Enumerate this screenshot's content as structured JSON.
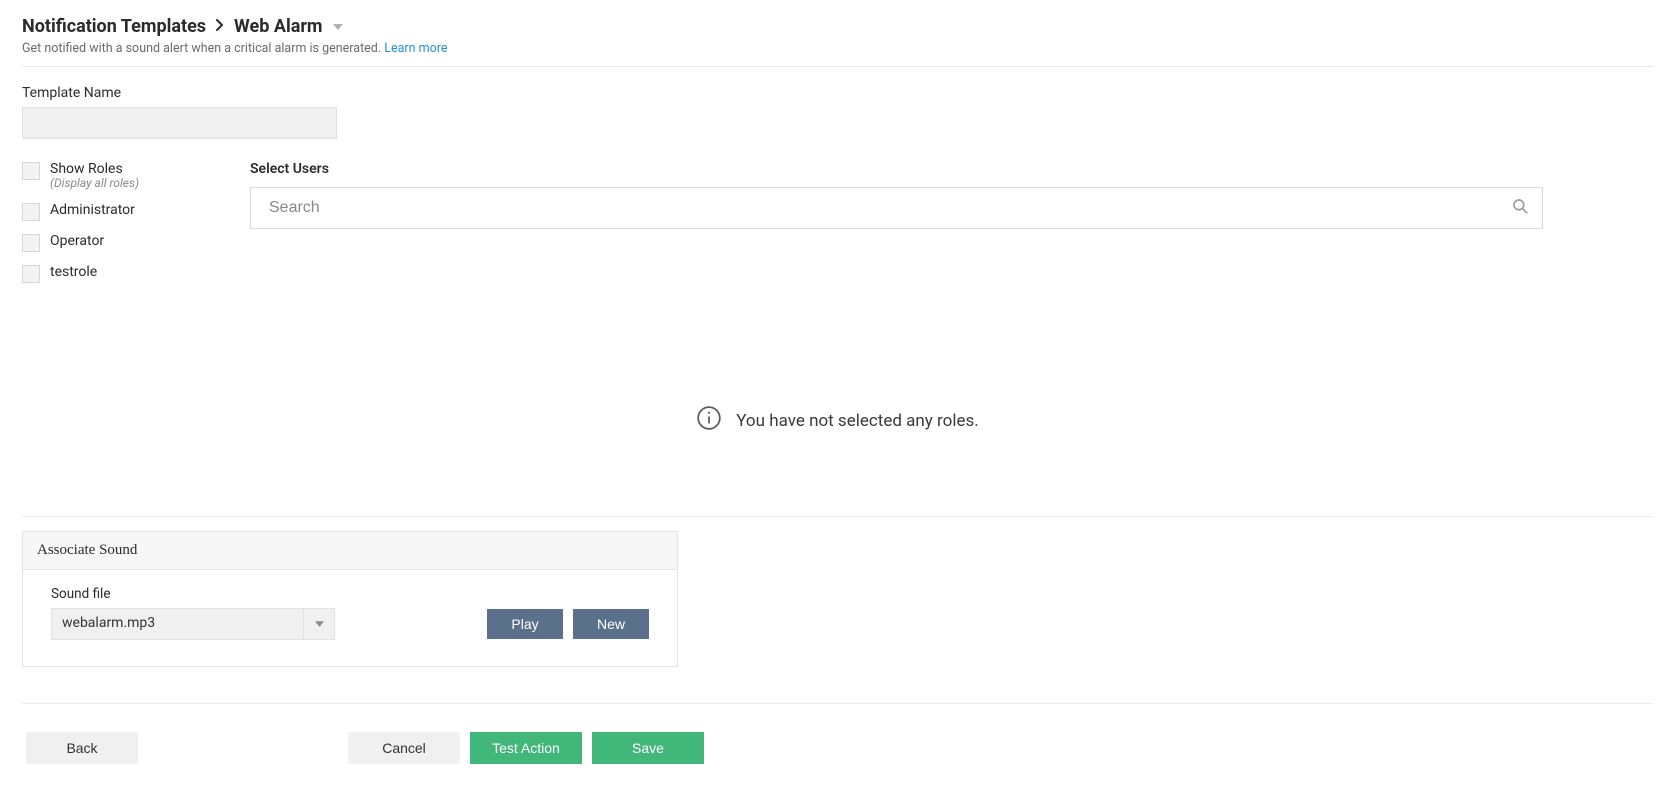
{
  "breadcrumb": {
    "parent": "Notification Templates",
    "current": "Web Alarm"
  },
  "subtitle": {
    "text": "Get notified with a sound alert when a critical alarm is generated.",
    "link": "Learn more"
  },
  "template_name": {
    "label": "Template Name",
    "value": ""
  },
  "roles": {
    "show": {
      "label": "Show Roles",
      "hint": "(Display all roles)"
    },
    "items": [
      {
        "label": "Administrator"
      },
      {
        "label": "Operator"
      },
      {
        "label": "testrole"
      }
    ]
  },
  "select_users": {
    "label": "Select Users",
    "search_placeholder": "Search"
  },
  "empty_message": "You have not selected any roles.",
  "sound": {
    "card_title": "Associate Sound",
    "file_label": "Sound file",
    "file_value": "webalarm.mp3",
    "play": "Play",
    "new": "New"
  },
  "actions": {
    "back": "Back",
    "cancel": "Cancel",
    "test": "Test Action",
    "save": "Save"
  }
}
